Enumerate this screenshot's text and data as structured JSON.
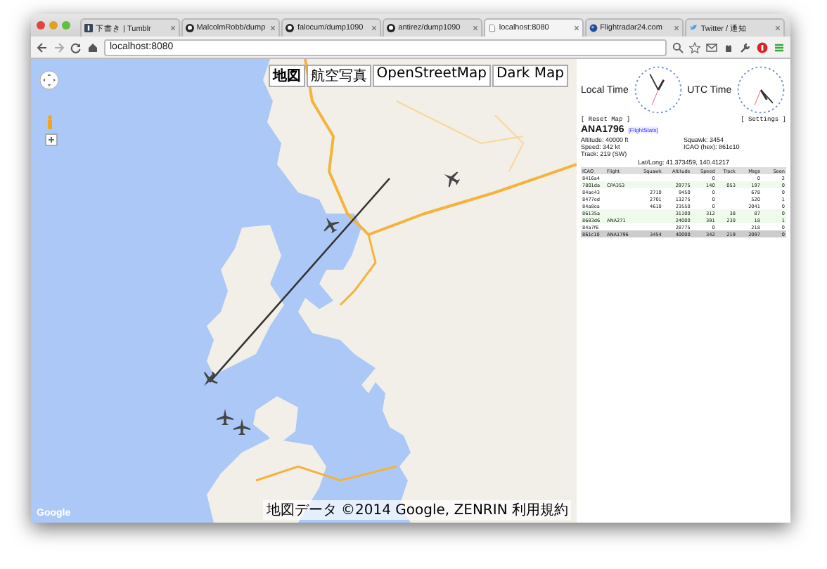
{
  "browser": {
    "tabs": [
      {
        "title": "下書き | Tumblr",
        "kind": "tumblr",
        "selected": false
      },
      {
        "title": "MalcolmRobb/dump",
        "kind": "github",
        "selected": false
      },
      {
        "title": "falocum/dump1090",
        "kind": "github",
        "selected": false
      },
      {
        "title": "antirez/dump1090",
        "kind": "github",
        "selected": false
      },
      {
        "title": "localhost:8080",
        "kind": "page",
        "selected": true
      },
      {
        "title": "Flightradar24.com",
        "kind": "globe",
        "selected": false
      },
      {
        "title": "Twitter / 通知",
        "kind": "bird",
        "selected": false
      }
    ],
    "url": "localhost:8080"
  },
  "map": {
    "map_types": [
      {
        "label": "地図",
        "selected": true
      },
      {
        "label": "航空写真",
        "selected": false
      },
      {
        "label": "OpenStreetMap",
        "selected": false
      },
      {
        "label": "Dark Map",
        "selected": false
      }
    ],
    "logo": "Google",
    "attribution": "地図データ ©2014 Google, ZENRIN 利用規約"
  },
  "sidebar": {
    "local_time_label": "Local Time",
    "utc_time_label": "UTC Time",
    "reset_map": "[ Reset Map ]",
    "settings": "[ Settings ]",
    "flight": {
      "callsign": "ANA1796",
      "link": "[FlightStats]",
      "altitude": "Altitude: 40000 ft",
      "squawk": "Squawk: 3454",
      "speed": "Speed: 342 kt",
      "icao": "ICAO (hex): 861c10",
      "track": "Track: 219 (SW)",
      "latlong": "Lat/Long: 41.373459, 140.41217"
    },
    "table": {
      "columns": [
        "ICAO",
        "Flight",
        "Squawk",
        "Altitude",
        "Speed",
        "Track",
        "Msgs",
        "Seen"
      ],
      "rows": [
        {
          "cells": [
            "8416a4",
            "",
            "",
            "",
            "0",
            "",
            "0",
            "2"
          ],
          "has_position": false,
          "selected": false
        },
        {
          "cells": [
            "7801da",
            "CPA353",
            "",
            "29775",
            "140",
            "053",
            "197",
            "0"
          ],
          "has_position": true,
          "selected": false
        },
        {
          "cells": [
            "84ae43",
            "",
            "2710",
            "9450",
            "0",
            "",
            "678",
            "0"
          ],
          "has_position": false,
          "selected": false
        },
        {
          "cells": [
            "8477ed",
            "",
            "2701",
            "13275",
            "0",
            "",
            "520",
            "1"
          ],
          "has_position": false,
          "selected": false
        },
        {
          "cells": [
            "84a8ea",
            "",
            "4610",
            "23550",
            "0",
            "",
            "2041",
            "0"
          ],
          "has_position": false,
          "selected": false
        },
        {
          "cells": [
            "86135a",
            "",
            "",
            "31100",
            "312",
            "38",
            "87",
            "0"
          ],
          "has_position": true,
          "selected": false
        },
        {
          "cells": [
            "8683d6",
            "ANA271",
            "",
            "24000",
            "391",
            "230",
            "18",
            "1"
          ],
          "has_position": true,
          "selected": false
        },
        {
          "cells": [
            "84a7f6",
            "",
            "",
            "28775",
            "0",
            "",
            "218",
            "0"
          ],
          "has_position": false,
          "selected": false
        },
        {
          "cells": [
            "861c10",
            "ANA1796",
            "3454",
            "40000",
            "342",
            "219",
            "2097",
            "0"
          ],
          "has_position": true,
          "selected": true
        }
      ]
    }
  }
}
